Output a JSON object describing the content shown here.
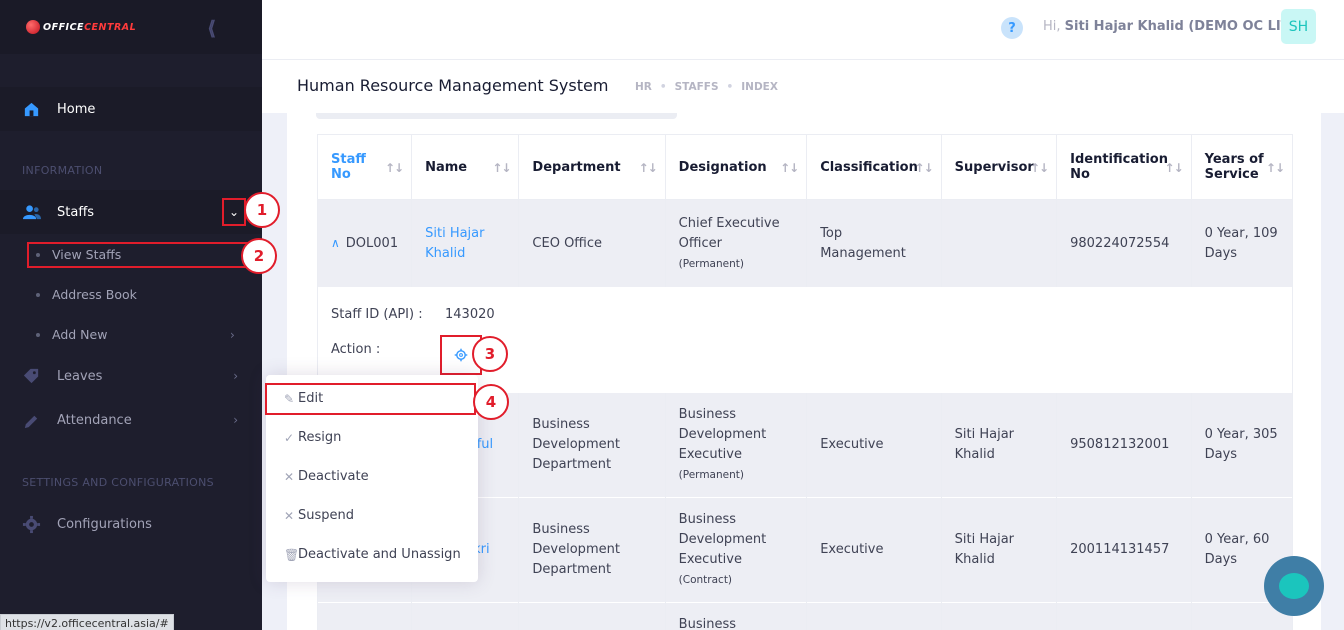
{
  "sidebar": {
    "brand_prefix": "OFFICE",
    "brand_suffix": "CENTRAL",
    "collapse_icon": "double-chevron-left",
    "home": "Home",
    "section_information": "INFORMATION",
    "staffs": "Staffs",
    "view_staffs": "View Staffs",
    "address_book": "Address Book",
    "add_new": "Add New",
    "leaves": "Leaves",
    "attendance": "Attendance",
    "section_settings": "SETTINGS AND CONFIGURATIONS",
    "configurations": "Configurations"
  },
  "header": {
    "help": "?",
    "greeting_prefix": "Hi,",
    "user_name": "Siti Hajar Khalid (DEMO OC LITE)",
    "avatar_initials": "SH"
  },
  "subheader": {
    "title": "Human Resource Management System",
    "breadcrumbs": [
      "HR",
      "STAFFS",
      "INDEX"
    ]
  },
  "table": {
    "columns": [
      "Staff No",
      "Name",
      "Department",
      "Designation",
      "Classification",
      "Supervisor",
      "Identification No",
      "Years of Service"
    ],
    "rows": [
      {
        "staff_no": "DOL001",
        "name": "Siti Hajar Khalid",
        "department": "CEO Office",
        "designation": "Chief Executive Officer",
        "employment": "(Permanent)",
        "classification": "Top Management",
        "supervisor": "",
        "identification": "980224072554",
        "service": "0 Year, 109 Days"
      },
      {
        "staff_no": "",
        "name": "iful",
        "department": "Business Development Department",
        "designation": "Business Development Executive",
        "employment": "(Permanent)",
        "classification": "Executive",
        "supervisor": "Siti Hajar Khalid",
        "identification": "950812132001",
        "service": "0 Year, 305 Days"
      },
      {
        "staff_no": "",
        "name": "kri",
        "department": "Business Development Department",
        "designation": "Business Development Executive",
        "employment": "(Contract)",
        "classification": "Executive",
        "supervisor": "Siti Hajar Khalid",
        "identification": "200114131457",
        "service": "0 Year, 60 Days"
      },
      {
        "designation": "Business"
      }
    ]
  },
  "detail": {
    "staff_id_label": "Staff ID (API) :",
    "staff_id_value": "143020",
    "action_label": "Action :"
  },
  "action_menu": {
    "edit": "Edit",
    "resign": "Resign",
    "deactivate": "Deactivate",
    "suspend": "Suspend",
    "deactivate_unassign": "Deactivate and Unassign"
  },
  "steps": [
    "1",
    "2",
    "3",
    "4"
  ],
  "status_url": "https://v2.officecentral.asia/#",
  "colors": {
    "sidebar_bg": "#1e1e2d",
    "accent": "#3699ff",
    "annotation_red": "#e11d2b",
    "row_highlight": "#edeef4"
  }
}
